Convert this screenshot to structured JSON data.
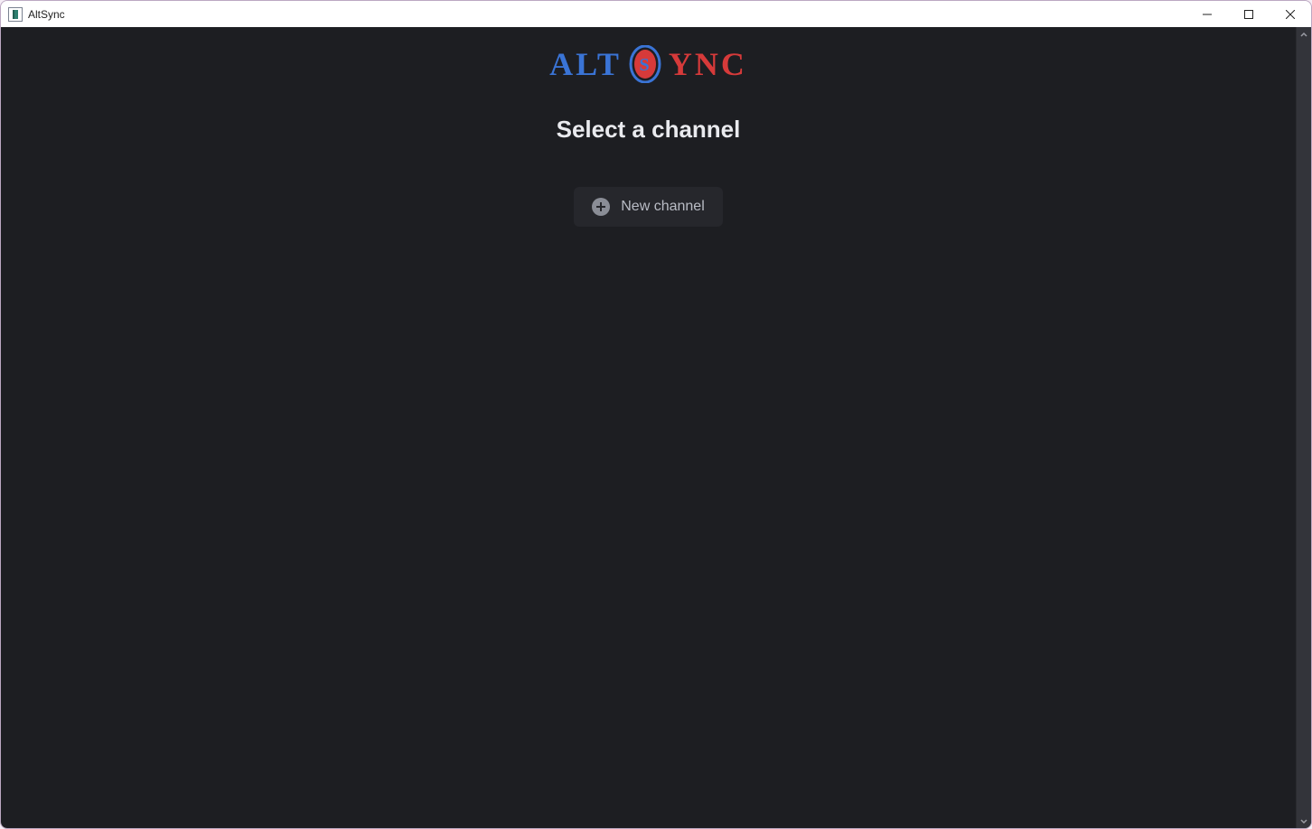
{
  "window": {
    "title": "AltSync"
  },
  "logo": {
    "left": "ALT",
    "middle": "S",
    "right": "YNC"
  },
  "main": {
    "heading": "Select a channel",
    "new_channel_label": "New channel"
  }
}
